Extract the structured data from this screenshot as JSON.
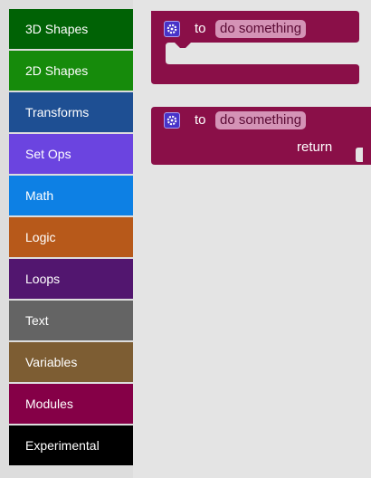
{
  "toolbox": {
    "categories": [
      {
        "label": "3D Shapes",
        "color": "#006205"
      },
      {
        "label": "2D Shapes",
        "color": "#168b0b"
      },
      {
        "label": "Transforms",
        "color": "#1e4f93"
      },
      {
        "label": "Set Ops",
        "color": "#6b44e0"
      },
      {
        "label": "Math",
        "color": "#0d80e4"
      },
      {
        "label": "Logic",
        "color": "#b7591a"
      },
      {
        "label": "Loops",
        "color": "#52166f"
      },
      {
        "label": "Text",
        "color": "#646464"
      },
      {
        "label": "Variables",
        "color": "#7d5d33"
      },
      {
        "label": "Modules",
        "color": "#850047"
      },
      {
        "label": "Experimental",
        "color": "#000000"
      }
    ]
  },
  "flyout": {
    "block_color": "#8a0f48",
    "procedure_block": {
      "to_label": "to",
      "name": "do something"
    },
    "function_block": {
      "to_label": "to",
      "name": "do something",
      "return_label": "return"
    }
  }
}
